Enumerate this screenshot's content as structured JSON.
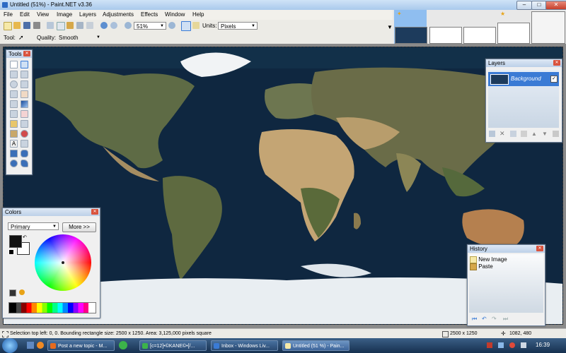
{
  "window": {
    "title": "Untitled (51%) - Paint.NET v3.36",
    "btn_min": "–",
    "btn_max": "□",
    "btn_close": "✕"
  },
  "menu": [
    "File",
    "Edit",
    "View",
    "Image",
    "Layers",
    "Adjustments",
    "Effects",
    "Window",
    "Help"
  ],
  "toolbar": {
    "zoom_value": "51%",
    "units_label": "Units:",
    "units_value": "Pixels"
  },
  "toolbar2": {
    "tool_label": "Tool:",
    "quality_label": "Quality:",
    "quality_value": "Smooth"
  },
  "tools_window": {
    "title": "Tools",
    "text_tool": "A"
  },
  "layers_window": {
    "title": "Layers",
    "layer_name": "Background"
  },
  "colors_window": {
    "title": "Colors",
    "mode": "Primary",
    "more_button": "More >>"
  },
  "history_window": {
    "title": "History",
    "items": [
      "New Image",
      "Paste"
    ]
  },
  "status": {
    "selection": "Selection top left: 0, 0. Bounding rectangle size: 2500 x 1250. Area: 3,125,000 pixels square",
    "size": "2500 x 1250",
    "cursor": "1082, 480"
  },
  "taskbar": {
    "tasks": [
      "Post a new topic - M...",
      "[c=12]•©KANE©•[/...",
      "Inbox - Windows Liv...",
      "Untitled (51 %) - Pain..."
    ],
    "clock": "16:39"
  },
  "colors": {
    "accent": "#3a7bd5",
    "ocean": "#0f2740"
  }
}
